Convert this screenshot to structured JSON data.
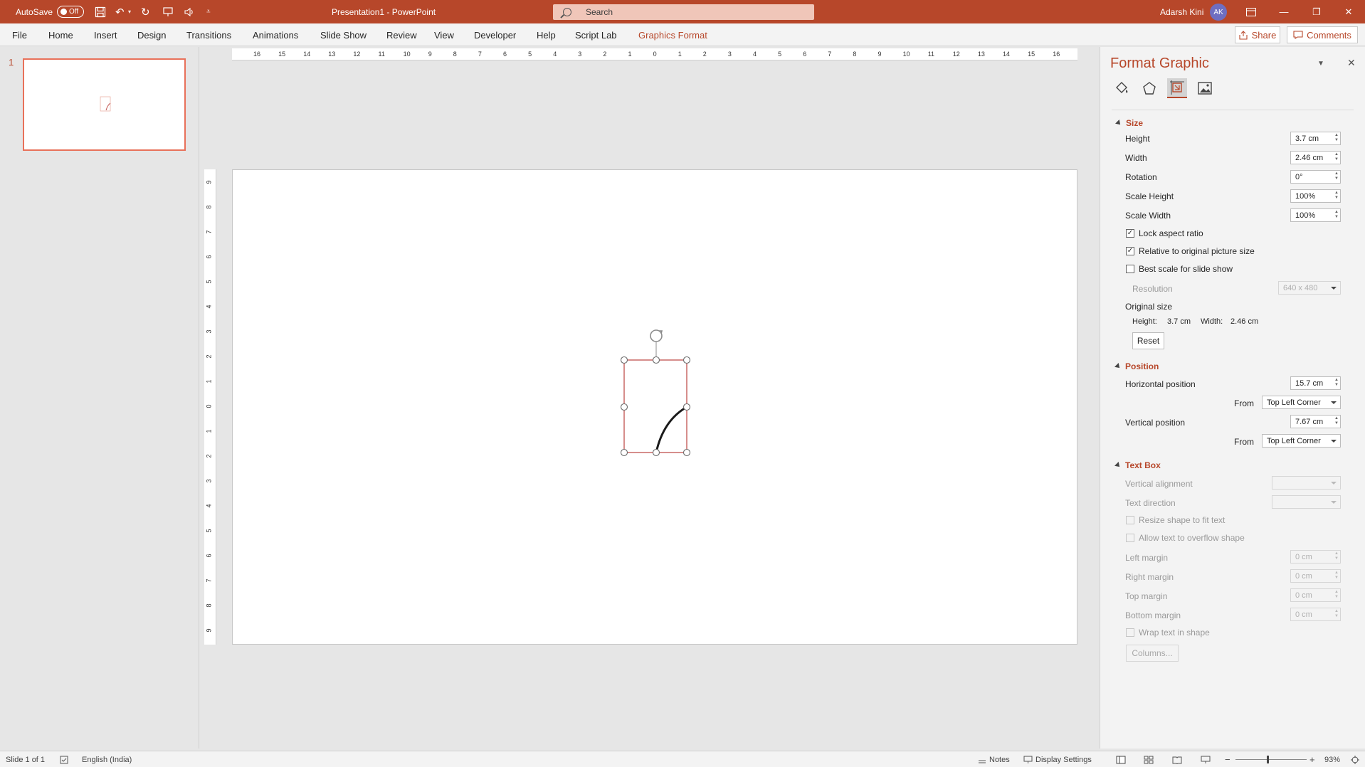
{
  "titlebar": {
    "autosave_label": "AutoSave",
    "autosave_state": "Off",
    "doc_title": "Presentation1  -  PowerPoint",
    "search_placeholder": "Search",
    "user_name": "Adarsh Kini",
    "user_initials": "AK"
  },
  "ribbon": {
    "tabs": [
      "File",
      "Home",
      "Insert",
      "Design",
      "Transitions",
      "Animations",
      "Slide Show",
      "Review",
      "View",
      "Developer",
      "Help",
      "Script Lab",
      "Graphics Format"
    ],
    "share_label": "Share",
    "comments_label": "Comments"
  },
  "thumbnails": {
    "slide_number": "1"
  },
  "rulers": {
    "h_ticks": [
      "16",
      "15",
      "14",
      "13",
      "12",
      "11",
      "10",
      "9",
      "8",
      "7",
      "6",
      "5",
      "4",
      "3",
      "2",
      "1",
      "0",
      "1",
      "2",
      "3",
      "4",
      "5",
      "6",
      "7",
      "8",
      "9",
      "10",
      "11",
      "12",
      "13",
      "14",
      "15",
      "16"
    ],
    "v_ticks": [
      "9",
      "8",
      "7",
      "6",
      "5",
      "4",
      "3",
      "2",
      "1",
      "0",
      "1",
      "2",
      "3",
      "4",
      "5",
      "6",
      "7",
      "8",
      "9"
    ]
  },
  "format_pane": {
    "title": "Format Graphic",
    "size_section": "Size",
    "height_label": "Height",
    "height_value": "3.7 cm",
    "width_label": "Width",
    "width_value": "2.46 cm",
    "rotation_label": "Rotation",
    "rotation_value": "0°",
    "scale_height_label": "Scale Height",
    "scale_height_value": "100%",
    "scale_width_label": "Scale Width",
    "scale_width_value": "100%",
    "lock_aspect_label": "Lock aspect ratio",
    "relative_label": "Relative to original picture size",
    "best_scale_label": "Best scale for slide show",
    "resolution_label": "Resolution",
    "resolution_value": "640 x 480",
    "original_size_label": "Original size",
    "orig_height_label": "Height:",
    "orig_height_value": "3.7 cm",
    "orig_width_label": "Width:",
    "orig_width_value": "2.46 cm",
    "reset_label": "Reset",
    "position_section": "Position",
    "hpos_label": "Horizontal position",
    "hpos_value": "15.7 cm",
    "from_label": "From",
    "hfrom_value": "Top Left Corner",
    "vpos_label": "Vertical position",
    "vpos_value": "7.67 cm",
    "vfrom_value": "Top Left Corner",
    "textbox_section": "Text Box",
    "valign_label": "Vertical alignment",
    "tdir_label": "Text direction",
    "resize_label": "Resize shape to fit text",
    "overflow_label": "Allow text to overflow shape",
    "left_margin_label": "Left margin",
    "left_margin_value": "0 cm",
    "right_margin_label": "Right margin",
    "right_margin_value": "0 cm",
    "top_margin_label": "Top margin",
    "top_margin_value": "0 cm",
    "bottom_margin_label": "Bottom margin",
    "bottom_margin_value": "0 cm",
    "wrap_label": "Wrap text in shape",
    "columns_label": "Columns..."
  },
  "statusbar": {
    "slide_info": "Slide 1 of 1",
    "language": "English (India)",
    "notes_label": "Notes",
    "display_settings_label": "Display Settings",
    "zoom_value": "93%"
  },
  "colors": {
    "accent": "#b7472a",
    "selection": "#c0504d"
  }
}
